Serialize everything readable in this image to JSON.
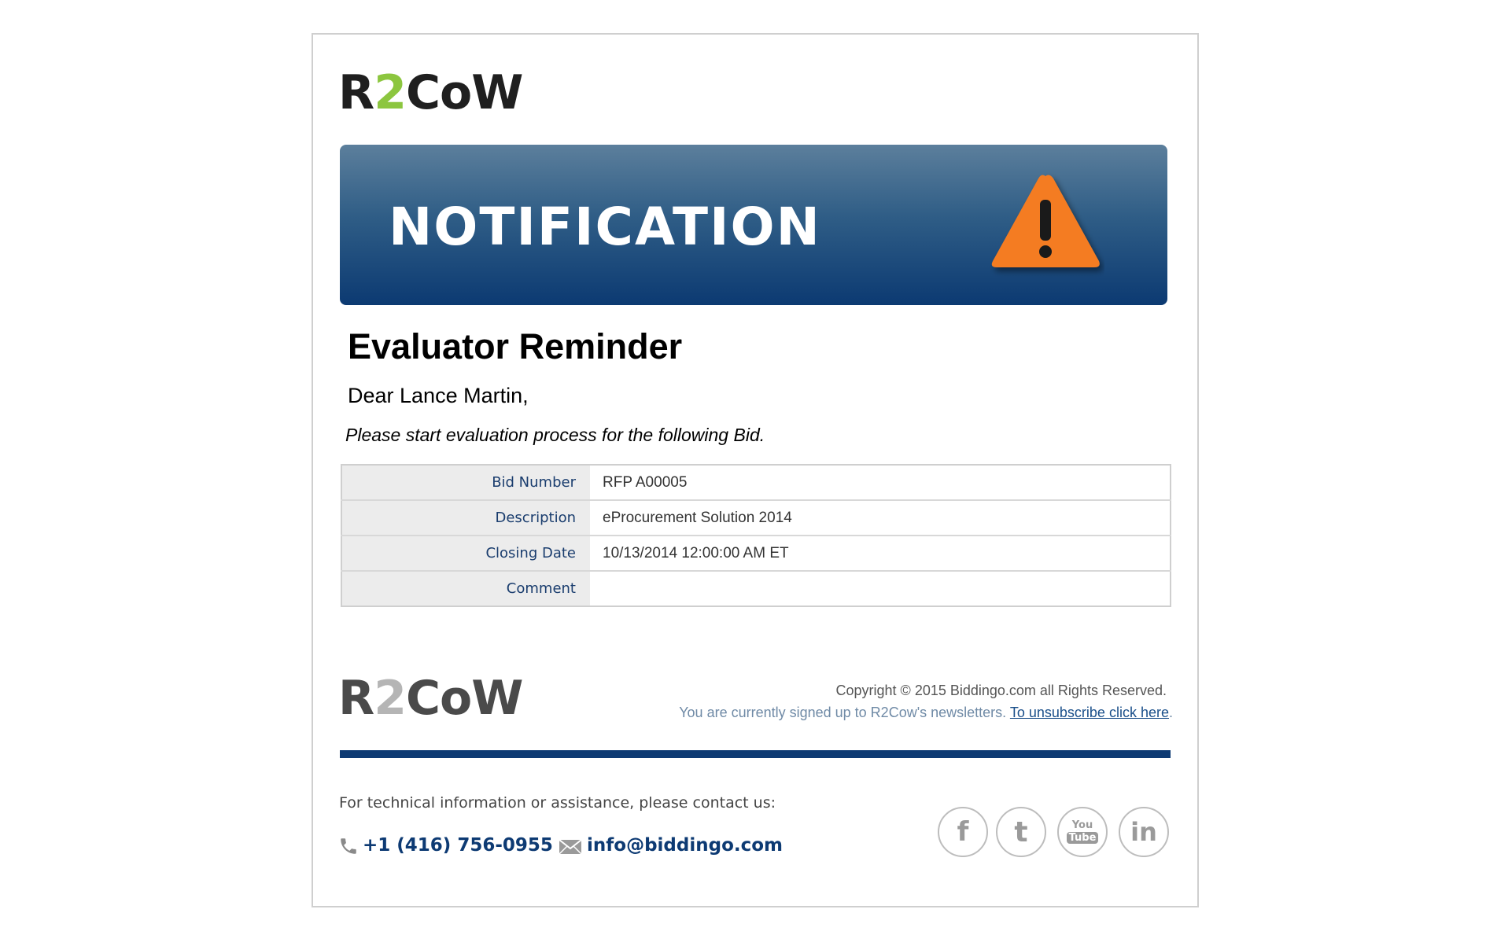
{
  "header": {
    "logo": {
      "part1": "R",
      "part2": "2",
      "part3": "CoW"
    }
  },
  "banner": {
    "title": "NOTIFICATION",
    "icon": "warning-triangle-icon",
    "colors": {
      "gradient_top": "#5c7f9c",
      "gradient_bottom": "#0c3a72",
      "icon": "#f47b20"
    }
  },
  "message": {
    "heading": "Evaluator Reminder",
    "greeting": "Dear Lance Martin,",
    "instruction": "Please start evaluation process for the following Bid."
  },
  "details": [
    {
      "label": "Bid Number",
      "value": "RFP A00005"
    },
    {
      "label": "Description",
      "value": "eProcurement Solution 2014"
    },
    {
      "label": "Closing Date",
      "value": "10/13/2014 12:00:00 AM ET"
    },
    {
      "label": "Comment",
      "value": ""
    }
  ],
  "footer": {
    "logo": {
      "part1": "R",
      "part2": "2",
      "part3": "CoW"
    },
    "copyright": "Copyright © 2015 Biddingo.com all Rights Reserved.",
    "newsletter_text": "You are currently signed up to R2Cow's newsletters.",
    "unsubscribe_link": "To unsubscribe click here",
    "contact_intro": "For technical information or assistance, please contact us:",
    "phone": "+1 (416) 756-0955",
    "email": "info@biddingo.com",
    "social": [
      {
        "name": "facebook-icon",
        "glyph": "f"
      },
      {
        "name": "twitter-icon",
        "glyph": "t"
      },
      {
        "name": "youtube-icon",
        "glyph_top": "You",
        "glyph_bottom": "Tube"
      },
      {
        "name": "linkedin-icon",
        "glyph": "in"
      }
    ],
    "accent_color": "#0d3a73"
  }
}
